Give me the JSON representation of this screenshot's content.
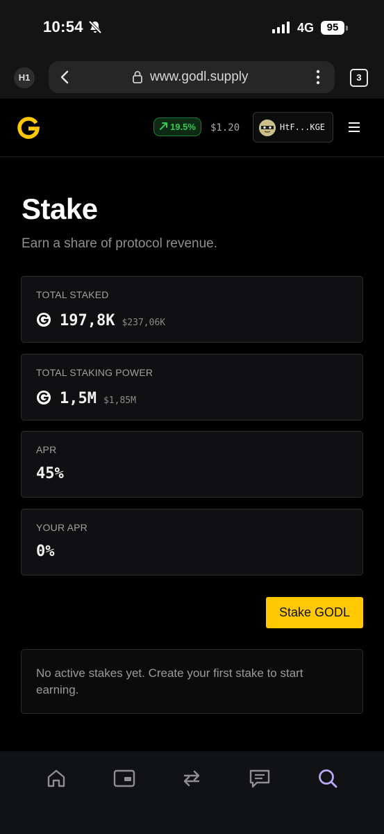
{
  "status_bar": {
    "time": "10:54",
    "network": "4G",
    "battery": "95",
    "icons": [
      "bell-slash-icon",
      "signal-bars-icon",
      "battery-icon"
    ]
  },
  "browser": {
    "tab_label": "H1",
    "url": "www.godl.supply",
    "tab_count": "3",
    "icons": [
      "back-chevron-icon",
      "lock-icon",
      "more-vertical-icon"
    ]
  },
  "header": {
    "logo_icon": "godl-logo-icon",
    "change_badge": "19.5%",
    "change_icon": "trend-up-arrow-icon",
    "price": "$1.20",
    "wallet_address": "HtF...KGE",
    "menu_icon": "hamburger-menu-icon"
  },
  "page": {
    "title": "Stake",
    "subtitle": "Earn a share of protocol revenue."
  },
  "stats": [
    {
      "label": "TOTAL STAKED",
      "value": "197,8K",
      "usd": "$237,06K",
      "has_coin": true
    },
    {
      "label": "TOTAL STAKING POWER",
      "value": "1,5M",
      "usd": "$1,85M",
      "has_coin": true
    },
    {
      "label": "APR",
      "value": "45%",
      "usd": "",
      "has_coin": false
    },
    {
      "label": "YOUR APR",
      "value": "0%",
      "usd": "",
      "has_coin": false
    }
  ],
  "actions": {
    "stake_button": "Stake GODL"
  },
  "empty_state": {
    "message": "No active stakes yet. Create your first stake to start earning."
  },
  "bottom_nav": [
    {
      "icon": "home-icon",
      "active": false
    },
    {
      "icon": "wallet-icon",
      "active": false
    },
    {
      "icon": "swap-arrows-icon",
      "active": false
    },
    {
      "icon": "message-icon",
      "active": false
    },
    {
      "icon": "search-icon",
      "active": true
    }
  ],
  "colors": {
    "accent": "#ffc800",
    "positive": "#34c759",
    "active_nav": "#b9a6f5",
    "inactive_nav": "#8e8e93"
  }
}
